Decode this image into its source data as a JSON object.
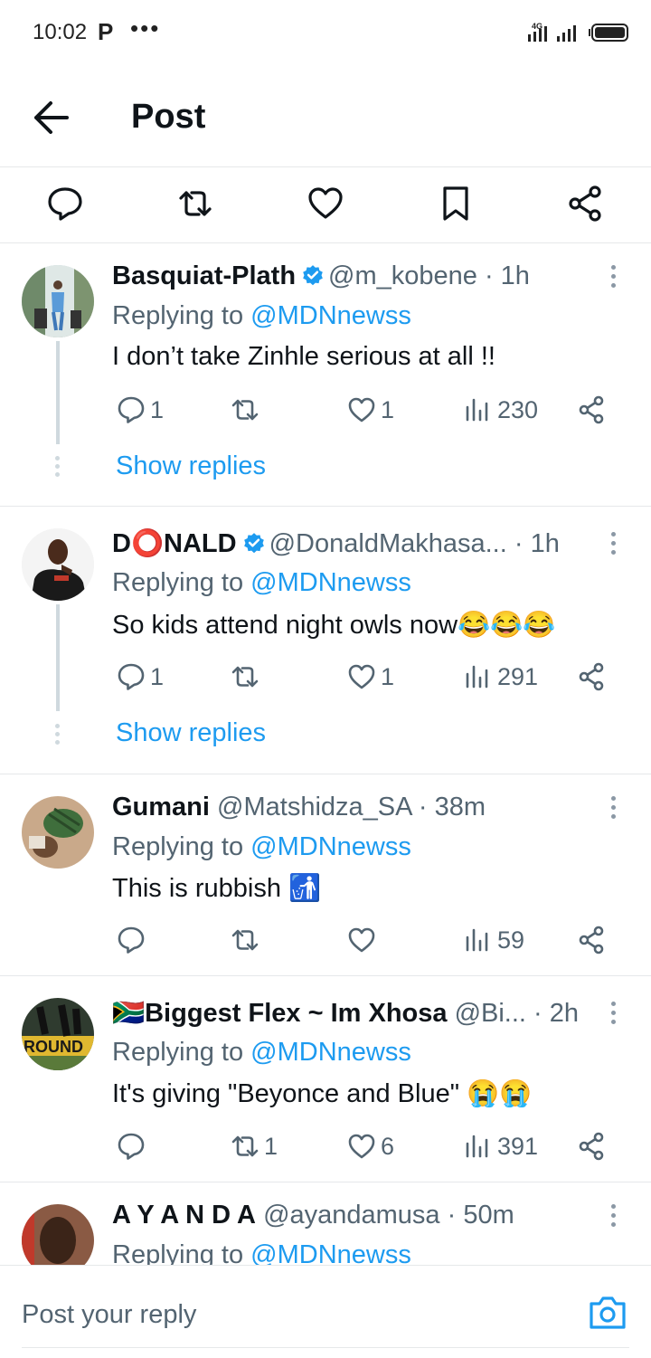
{
  "status_bar": {
    "time": "10:02",
    "app_icon": "P",
    "more": "•••",
    "network": "4G"
  },
  "header": {
    "title": "Post"
  },
  "action_bar": [
    "reply-icon",
    "repost-icon",
    "like-icon",
    "bookmark-icon",
    "share-icon"
  ],
  "colors": {
    "accent": "#1d9bf0",
    "text": "#0f1419",
    "muted": "#536471",
    "divider": "#e6e8ea"
  },
  "replies": [
    {
      "name": "Basquiat-Plath",
      "verified": true,
      "handle": "@m_kobene",
      "time": "· 1h",
      "replying_prefix": "Replying to ",
      "replying_to": "@MDNnewss",
      "text": "I don’t take Zinhle serious at all !!",
      "stats": {
        "replies": "1",
        "reposts": "",
        "likes": "1",
        "views": "230"
      },
      "show_replies": "Show replies"
    },
    {
      "name": "D⭕NALD",
      "verified": true,
      "handle": "@DonaldMakhasa...",
      "time": "· 1h",
      "replying_prefix": "Replying to ",
      "replying_to": "@MDNnewss",
      "text": "So kids attend night owls now😂😂😂",
      "stats": {
        "replies": "1",
        "reposts": "",
        "likes": "1",
        "views": "291"
      },
      "show_replies": "Show replies"
    },
    {
      "name": "Gumani",
      "verified": false,
      "handle": "@Matshidza_SA",
      "time": "· 38m",
      "replying_prefix": "Replying to ",
      "replying_to": "@MDNnewss",
      "text": "This is rubbish 🚮",
      "stats": {
        "replies": "",
        "reposts": "",
        "likes": "",
        "views": "59"
      }
    },
    {
      "name": "🇿🇦Biggest Flex ~ Im Xhosa",
      "verified": false,
      "handle": "@Bi...",
      "time": "· 2h",
      "replying_prefix": "Replying to ",
      "replying_to": "@MDNnewss",
      "text": "It's giving \"Beyonce and Blue\" 😭😭",
      "stats": {
        "replies": "",
        "reposts": "1",
        "likes": "6",
        "views": "391"
      }
    },
    {
      "name": "A Y A N D A",
      "verified": false,
      "handle": "@ayandamusa",
      "time": "· 50m",
      "replying_prefix": "Replying to ",
      "replying_to": "@MDNnewss"
    }
  ],
  "composer": {
    "placeholder": "Post your reply"
  }
}
